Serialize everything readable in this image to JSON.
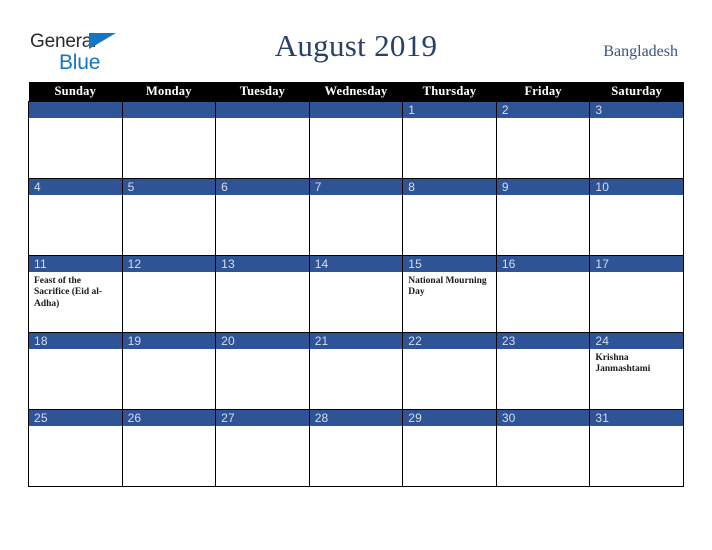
{
  "brand": {
    "line1": "General",
    "line2": "Blue",
    "triangle_color": "#1277c4",
    "text_color": "#2b2b2b"
  },
  "header": {
    "title": "August 2019",
    "country": "Bangladesh",
    "title_color": "#28406b"
  },
  "calendar": {
    "weekday_headers": [
      "Sunday",
      "Monday",
      "Tuesday",
      "Wednesday",
      "Thursday",
      "Friday",
      "Saturday"
    ],
    "header_bg": "#000000",
    "daynum_bg": "#2f5496",
    "daynum_color": "#d6dce8",
    "weeks": [
      [
        {
          "day": "",
          "events": []
        },
        {
          "day": "",
          "events": []
        },
        {
          "day": "",
          "events": []
        },
        {
          "day": "",
          "events": []
        },
        {
          "day": "1",
          "events": []
        },
        {
          "day": "2",
          "events": []
        },
        {
          "day": "3",
          "events": []
        }
      ],
      [
        {
          "day": "4",
          "events": []
        },
        {
          "day": "5",
          "events": []
        },
        {
          "day": "6",
          "events": []
        },
        {
          "day": "7",
          "events": []
        },
        {
          "day": "8",
          "events": []
        },
        {
          "day": "9",
          "events": []
        },
        {
          "day": "10",
          "events": []
        }
      ],
      [
        {
          "day": "11",
          "events": [
            "Feast of the Sacrifice (Eid al-Adha)"
          ]
        },
        {
          "day": "12",
          "events": []
        },
        {
          "day": "13",
          "events": []
        },
        {
          "day": "14",
          "events": []
        },
        {
          "day": "15",
          "events": [
            "National Mourning Day"
          ]
        },
        {
          "day": "16",
          "events": []
        },
        {
          "day": "17",
          "events": []
        }
      ],
      [
        {
          "day": "18",
          "events": []
        },
        {
          "day": "19",
          "events": []
        },
        {
          "day": "20",
          "events": []
        },
        {
          "day": "21",
          "events": []
        },
        {
          "day": "22",
          "events": []
        },
        {
          "day": "23",
          "events": []
        },
        {
          "day": "24",
          "events": [
            "Krishna Janmashtami"
          ]
        }
      ],
      [
        {
          "day": "25",
          "events": []
        },
        {
          "day": "26",
          "events": []
        },
        {
          "day": "27",
          "events": []
        },
        {
          "day": "28",
          "events": []
        },
        {
          "day": "29",
          "events": []
        },
        {
          "day": "30",
          "events": []
        },
        {
          "day": "31",
          "events": []
        }
      ]
    ]
  }
}
